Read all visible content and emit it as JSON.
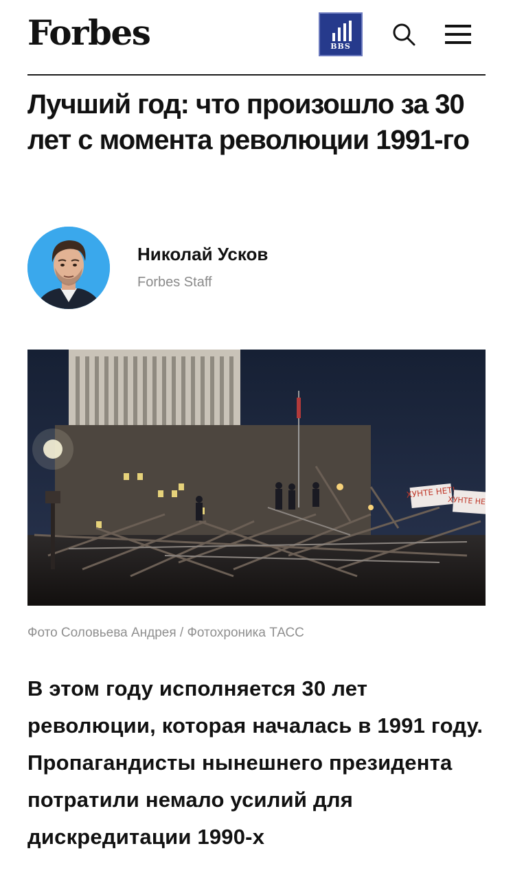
{
  "header": {
    "logo": "Forbes",
    "bbs_label": "BBS",
    "icons": [
      "bbs-bars-icon",
      "search-icon",
      "menu-icon"
    ],
    "bbs_color": "#263a8c"
  },
  "article": {
    "headline": "Лучший год: что произошло за 30 лет с момента революции 1991-го",
    "author": {
      "name": "Николай Усков",
      "role": "Forbes Staff"
    },
    "photo": {
      "sign_1": "ХУНТЕ НЕТ!",
      "sign_2": "ХУНТЕ НЕТ!"
    },
    "photo_caption": "Фото Соловьева Андрея / Фотохроника ТАСС",
    "lead": "В этом году исполняется 30 лет революции, которая началась в 1991 году. Пропагандисты нынешнего президента потратили немало усилий для дискредитации 1990-х"
  }
}
